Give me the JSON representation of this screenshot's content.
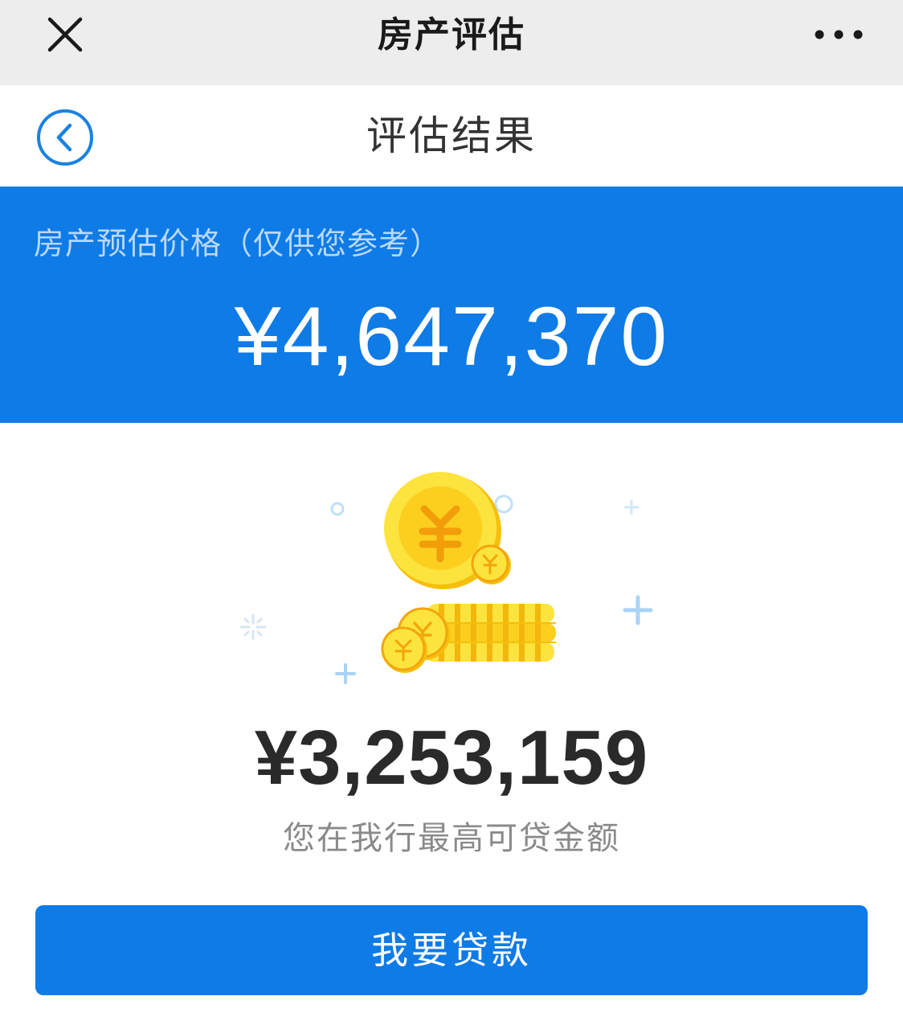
{
  "topbar": {
    "title": "房产评估",
    "close_icon": "close-icon",
    "more_icon": "more-dots-icon"
  },
  "header": {
    "title": "评估结果",
    "back_icon": "back-chevron-icon"
  },
  "banner": {
    "label": "房产预估价格（仅供您参考）",
    "value": "¥4,647,370"
  },
  "illustration": {
    "icon": "gold-coins-icon"
  },
  "loan": {
    "value": "¥3,253,159",
    "caption": "您在我行最高可贷金额"
  },
  "cta": {
    "label": "我要贷款"
  },
  "colors": {
    "primary_blue": "#0e7be6",
    "topbar_bg": "#ededed",
    "coin_gold": "#fdd11b"
  }
}
